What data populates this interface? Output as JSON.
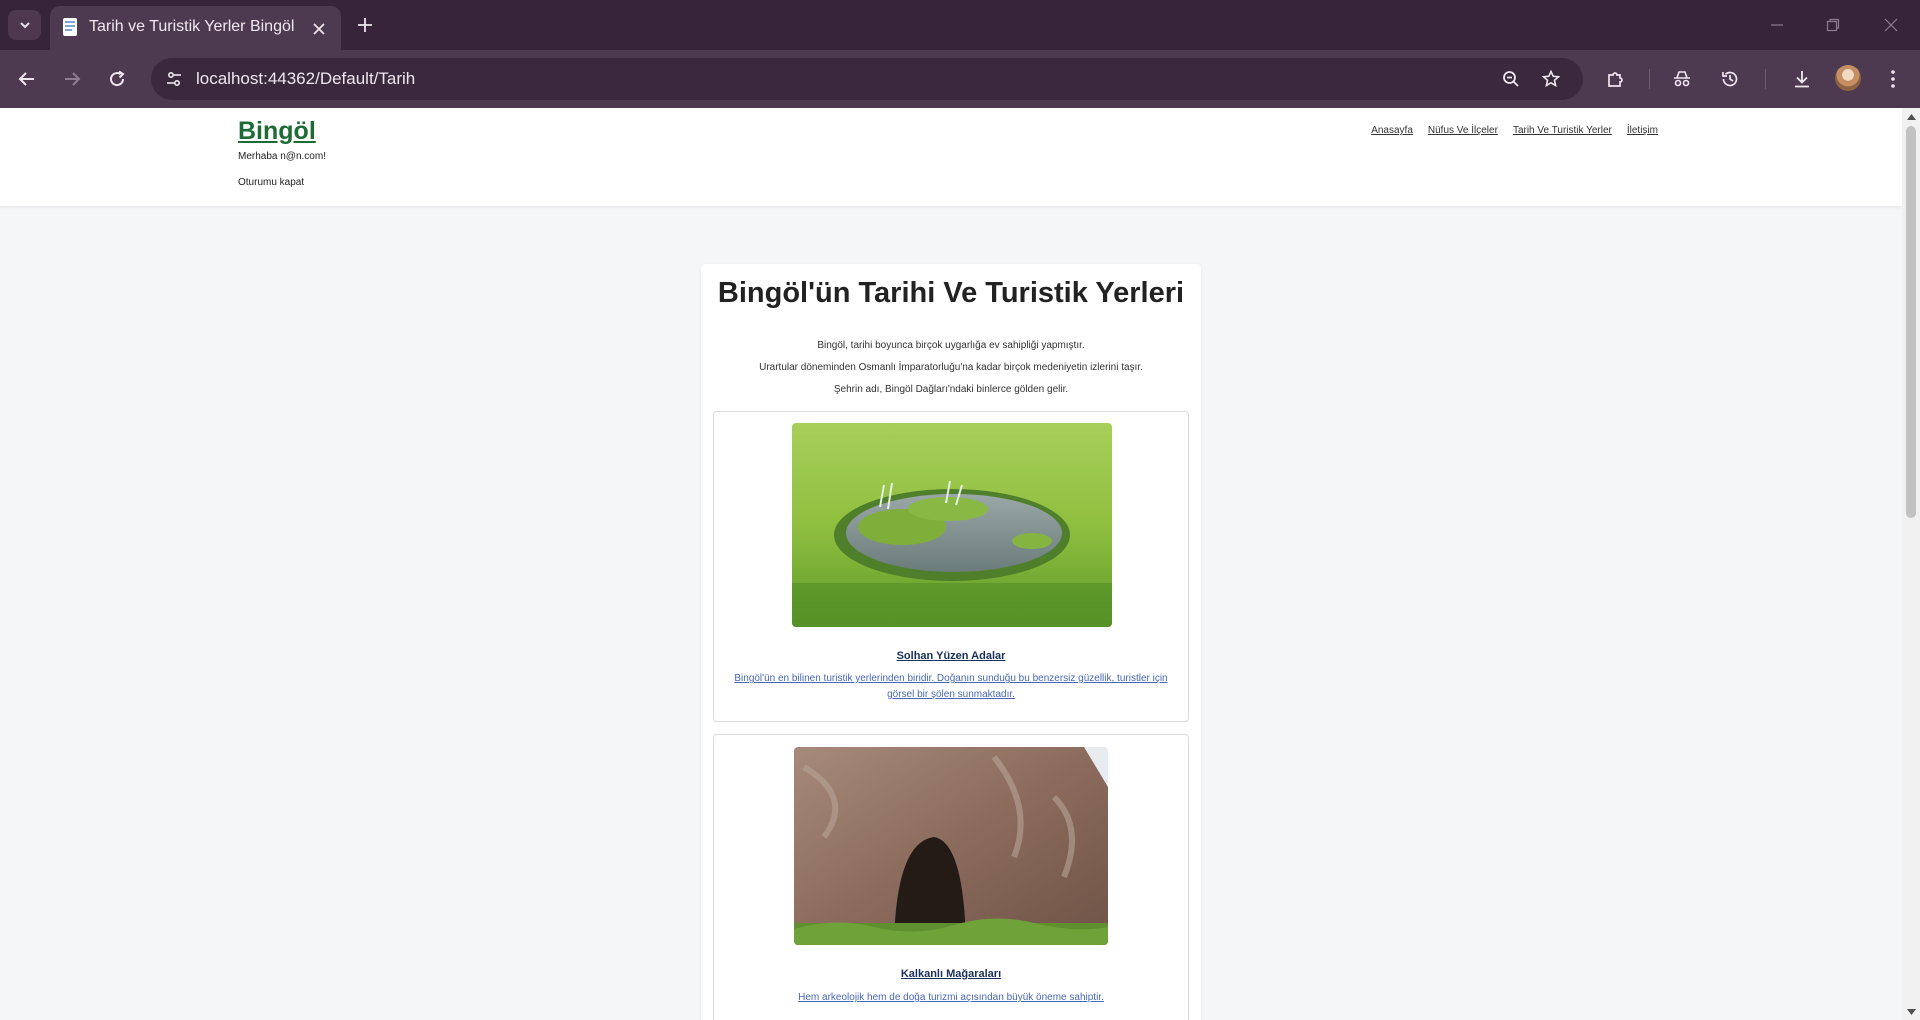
{
  "browser": {
    "tab_title": "Tarih ve Turistik Yerler Bingöl",
    "url": "localhost:44362/Default/Tarih"
  },
  "site": {
    "brand": "Bingöl",
    "greeting": "Merhaba n@n.com!",
    "logout": "Oturumu kapat",
    "nav": [
      "Anasayfa",
      "Nüfus Ve İlçeler",
      "Tarih Ve Turistik Yerler",
      "İletişim"
    ]
  },
  "page": {
    "title": "Bingöl'ün Tarihi Ve Turistik Yerleri",
    "intro": [
      "Bingöl, tarihi boyunca birçok uygarlığa ev sahipliği yapmıştır.",
      "Urartular döneminden Osmanlı İmparatorluğu'na kadar birçok medeniyetin izlerini taşır.",
      "Şehrin adı, Bingöl Dağları'ndaki binlerce gölden gelir."
    ],
    "places": [
      {
        "name": "Solhan Yüzen Adalar",
        "desc": "Bingöl'ün en bilinen turistik yerlerinden biridir. Doğanın sunduğu bu benzersiz güzellik, turistler için görsel bir şölen sunmaktadır.",
        "image_icon": "floating-islands-photo"
      },
      {
        "name": "Kalkanlı Mağaraları",
        "desc": "Hem arkeolojik hem de doğa turizmi açısından büyük öneme sahiptir.",
        "image_icon": "cave-photo"
      }
    ]
  },
  "colors": {
    "tabstrip": "#38243a",
    "toolbar": "#4e3a50",
    "brand": "#1f6b36",
    "link_desc": "#4a67b5"
  }
}
